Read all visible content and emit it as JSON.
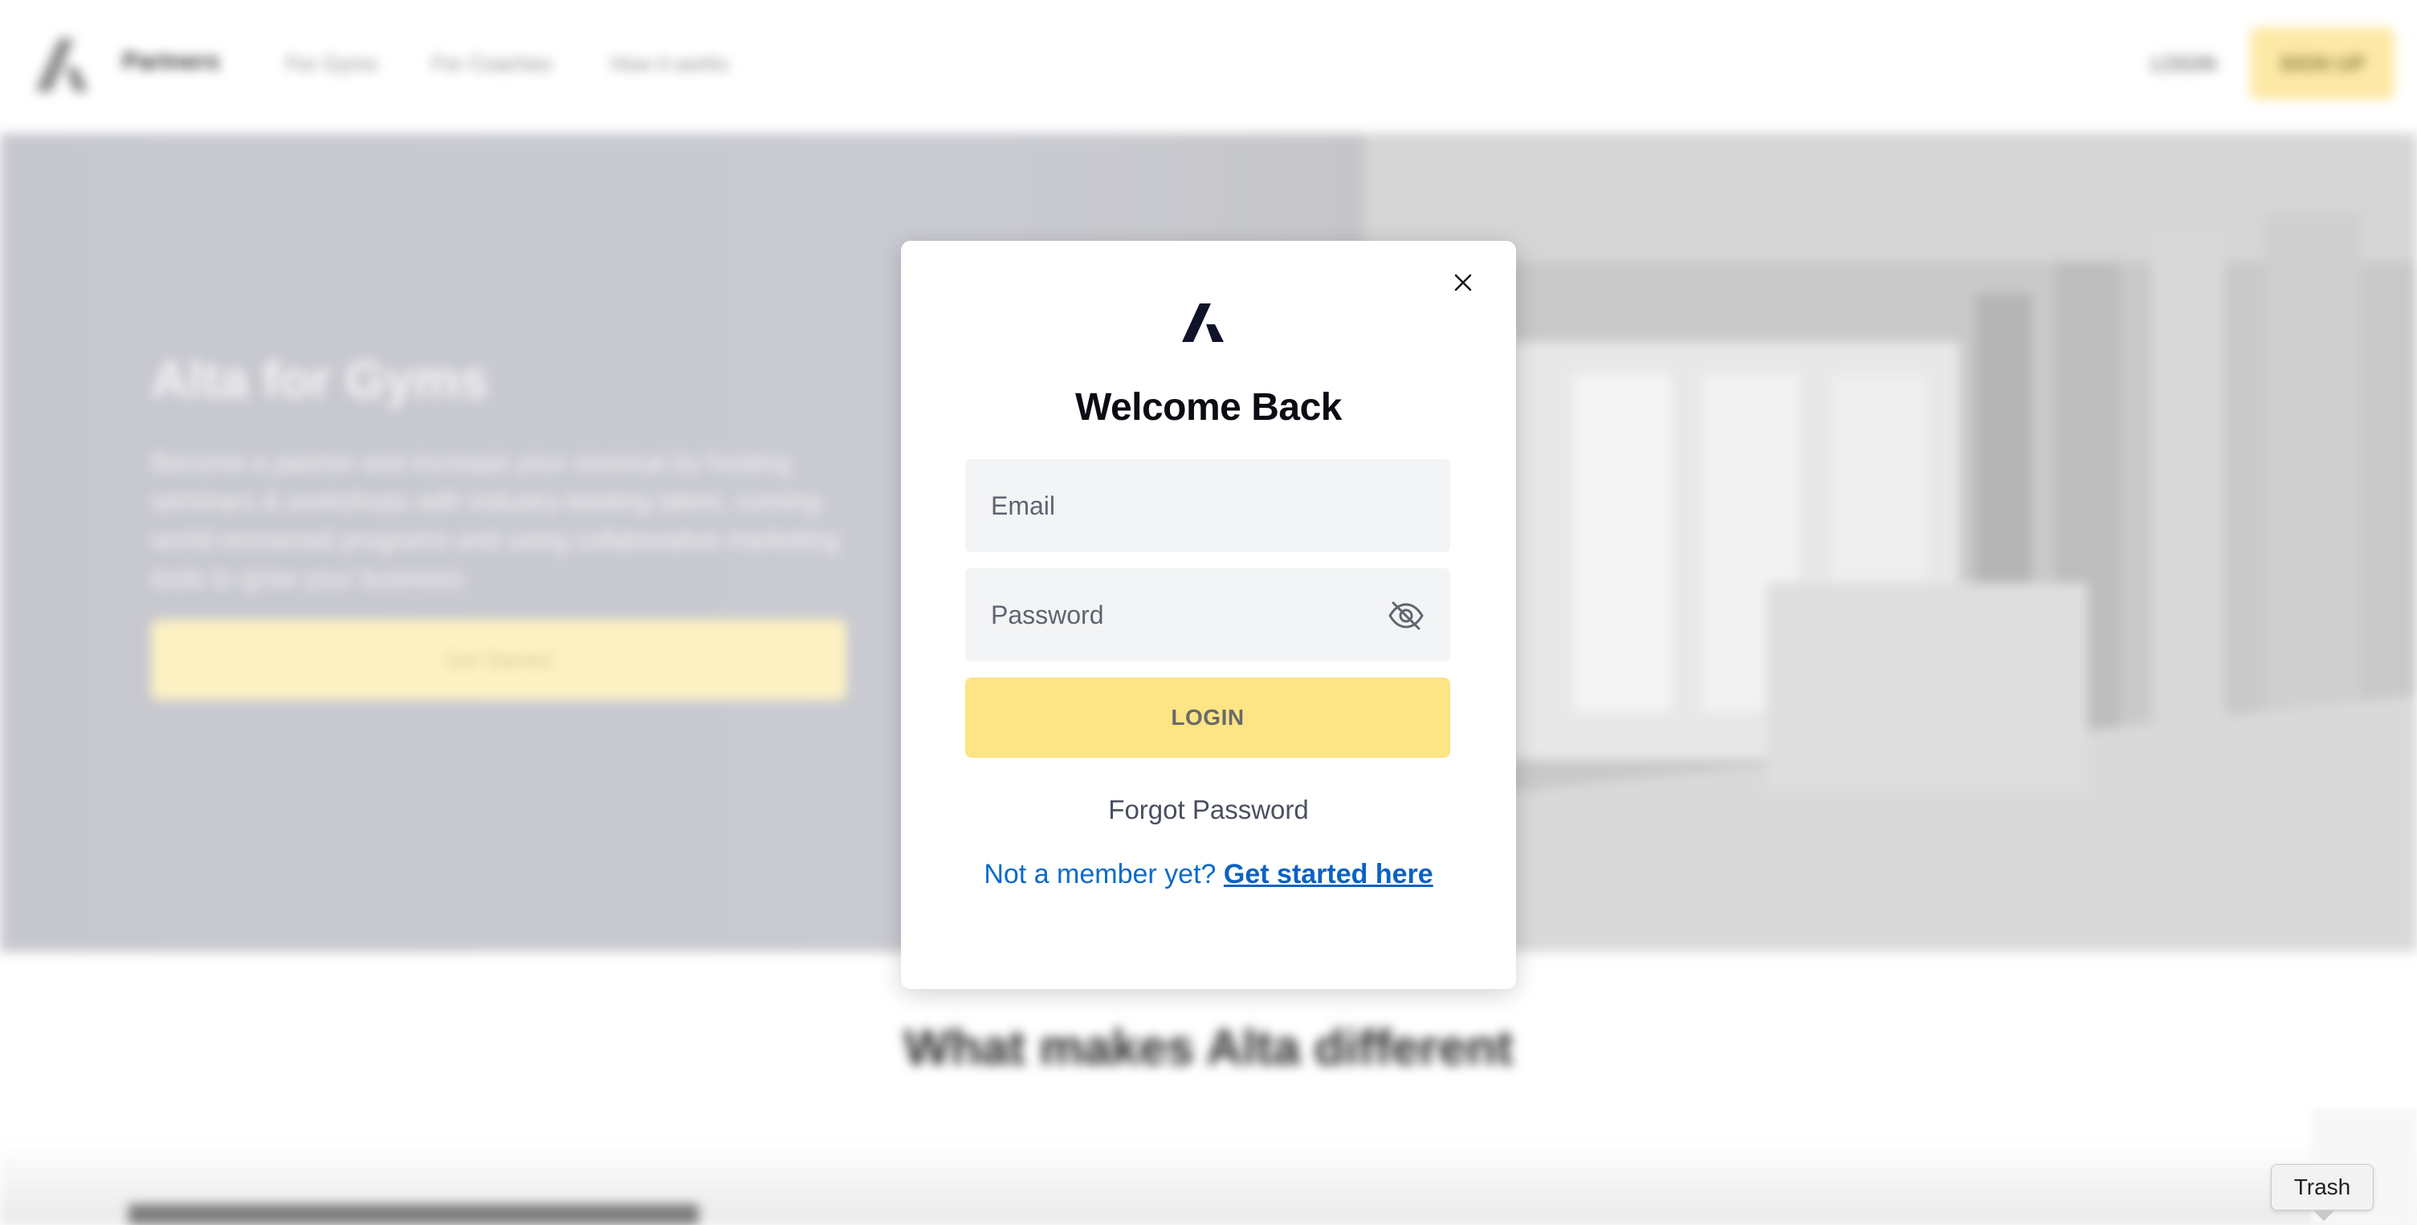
{
  "background": {
    "nav": {
      "brand": "Partners",
      "links": [
        "For Gyms",
        "For Coaches",
        "How it works"
      ],
      "login_label": "LOGIN",
      "signup_label": "SIGN UP"
    },
    "hero": {
      "title": "Alta for Gyms",
      "body": "Become a partner and increase your revenue by hosting seminars & workshops with industry-leading talent, running world-renowned programs and using collaborative marketing tools to grow your business.",
      "cta_label": "Get Started"
    },
    "section_title": "What makes Alta different"
  },
  "modal": {
    "title": "Welcome Back",
    "email_placeholder": "Email",
    "password_placeholder": "Password",
    "login_label": "LOGIN",
    "forgot_label": "Forgot Password",
    "member_prefix": "Not a member yet?",
    "member_link": "Get started here"
  },
  "tooltip": {
    "text": "Trash"
  },
  "icons": {
    "close": "close-icon",
    "logo": "alta-logo-icon",
    "password_toggle": "eye-off-icon"
  },
  "colors": {
    "login_button": "#fde484",
    "link": "#0a62c4",
    "title": "#0c0c14"
  }
}
